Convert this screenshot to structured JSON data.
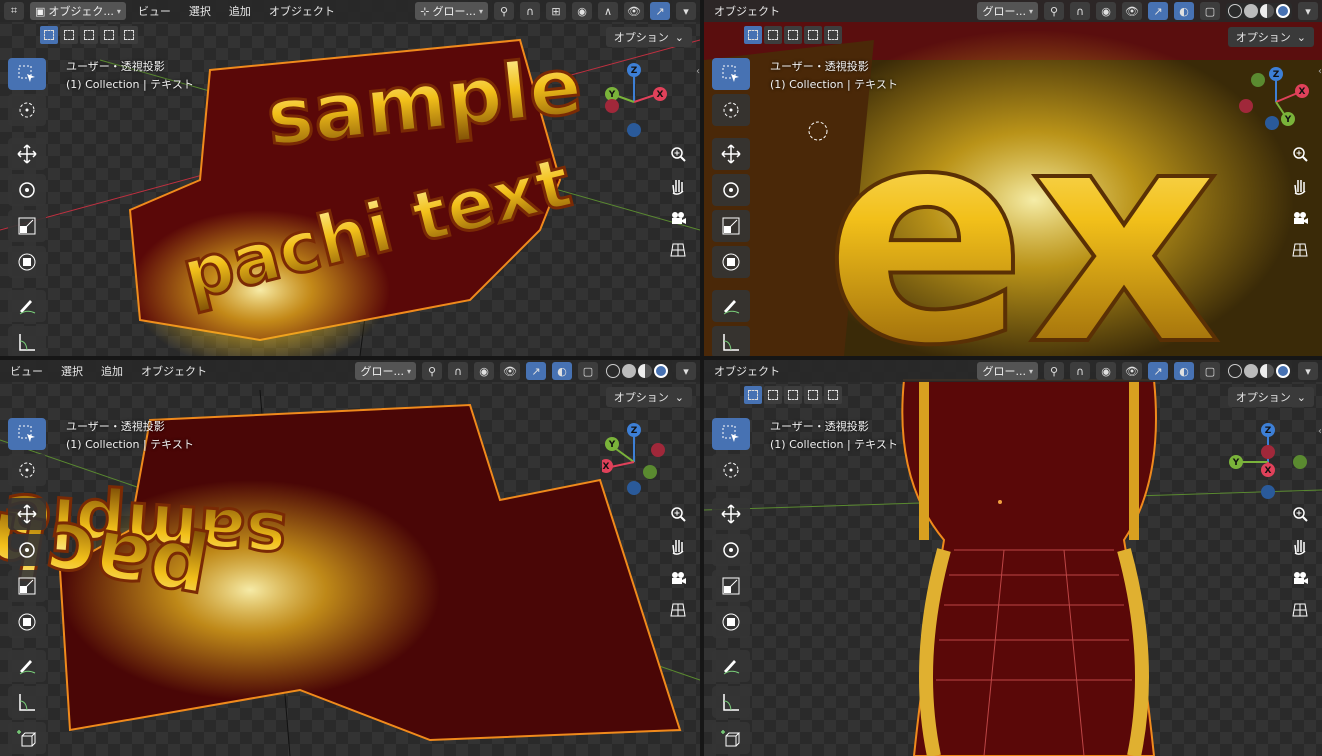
{
  "colors": {
    "accent": "#4772b3",
    "header_bg": "#282828",
    "axis_x": "#e0415a",
    "axis_y": "#7ab33a",
    "axis_z": "#3d7fd6",
    "selection_outline": "#f08a1c"
  },
  "viewports": {
    "top_left": {
      "menus": [
        "ビュー",
        "選択",
        "追加",
        "オブジェクト"
      ],
      "mode_label": "オブジェク...",
      "transform_label": "グロー...",
      "options_label": "オプション",
      "info_line1": "ユーザー・透視投影",
      "info_line2": "(1) Collection | テキスト"
    },
    "top_right": {
      "menus": [
        "オブジェクト"
      ],
      "transform_label": "グロー...",
      "options_label": "オプション",
      "info_line1": "ユーザー・透視投影",
      "info_line2": "(1) Collection | テキスト"
    },
    "bottom_left": {
      "menus": [
        "ビュー",
        "選択",
        "追加",
        "オブジェクト"
      ],
      "transform_label": "グロー...",
      "options_label": "オプション",
      "info_line1": "ユーザー・透視投影",
      "info_line2": "(1) Collection | テキスト"
    },
    "bottom_right": {
      "menus": [
        "オブジェクト"
      ],
      "transform_label": "グロー...",
      "options_label": "オプション",
      "info_line1": "ユーザー・透視投影",
      "info_line2": "(1) Collection | テキスト"
    }
  },
  "gizmo_labels": {
    "x": "X",
    "y": "Y",
    "z": "Z"
  },
  "scene_text": {
    "word1": "sample",
    "word2": "pachi text",
    "closeup": "ex"
  },
  "icons": [
    "select-box-icon",
    "cursor-icon",
    "move-icon",
    "rotate-icon",
    "scale-icon",
    "transform-icon",
    "annotate-icon",
    "measure-icon",
    "add-cube-icon",
    "zoom-icon",
    "pan-hand-icon",
    "camera-icon",
    "grid-ortho-icon"
  ]
}
